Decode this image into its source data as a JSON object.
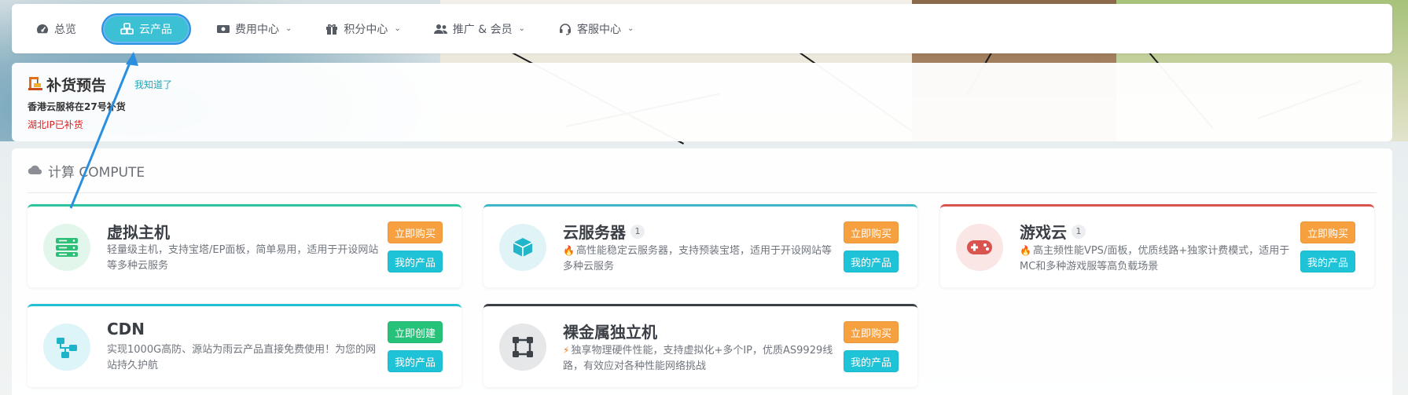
{
  "nav": {
    "items": [
      {
        "label": "总览",
        "icon": "dashboard-icon",
        "has_dropdown": false
      },
      {
        "label": "云产品",
        "icon": "cubes-icon",
        "has_dropdown": false,
        "active": true
      },
      {
        "label": "费用中心",
        "icon": "money-icon",
        "has_dropdown": true
      },
      {
        "label": "积分中心",
        "icon": "gift-icon",
        "has_dropdown": true
      },
      {
        "label": "推广 & 会员",
        "icon": "users-icon",
        "has_dropdown": true
      },
      {
        "label": "客服中心",
        "icon": "headset-icon",
        "has_dropdown": true
      }
    ]
  },
  "notice": {
    "icon": "construction-icon",
    "title": "补货预告",
    "ack": "我知道了",
    "line1": "香港云服将在27号补货",
    "line2": "湖北IP已补货"
  },
  "section": {
    "icon": "cloud-icon",
    "title": "计算 COMPUTE"
  },
  "cards": [
    {
      "title": "虚拟主机",
      "badge": "",
      "hot": false,
      "icon": "server-icon",
      "desc": "轻量级主机，支持宝塔/EP面板，简单易用，适用于开设网站等多种云服务",
      "primary": "立即购买",
      "secondary": "我的产品"
    },
    {
      "title": "云服务器",
      "badge": "1",
      "hot": true,
      "icon": "box-icon",
      "desc": "高性能稳定云服务器，支持预装宝塔，适用于开设网站等多种云服务",
      "primary": "立即购买",
      "secondary": "我的产品"
    },
    {
      "title": "游戏云",
      "badge": "1",
      "hot": true,
      "icon": "gamepad-icon",
      "desc": "高主频性能VPS/面板，优质线路+独家计费模式，适用于MC和多种游戏服等高负载场景",
      "primary": "立即购买",
      "secondary": "我的产品"
    },
    {
      "title": "CDN",
      "badge": "",
      "hot": false,
      "icon": "network-icon",
      "desc": "实现1000G高防、源站为雨云产品直接免费使用！为您的网站持久护航",
      "primary": "立即创建",
      "secondary": "我的产品"
    },
    {
      "title": "裸金属独立机",
      "badge": "",
      "hot": true,
      "icon": "bare-metal-icon",
      "desc": "独享物理硬件性能，支持虚拟化+多个IP，优质AS9929线路，有效应对各种性能网络挑战",
      "primary": "立即购买",
      "secondary": "我的产品"
    }
  ],
  "colors": {
    "accent_cyan": "#1fc3d8",
    "buy_orange": "#f6a040",
    "create_green": "#26c27a",
    "card1_top": "#2fc4a0",
    "card2_top": "#3fb6c8",
    "card3_top": "#d9534f",
    "card4_top": "#22c0d4",
    "card5_top": "#3a3e45",
    "annotation_arrow": "#2b8fe0"
  }
}
